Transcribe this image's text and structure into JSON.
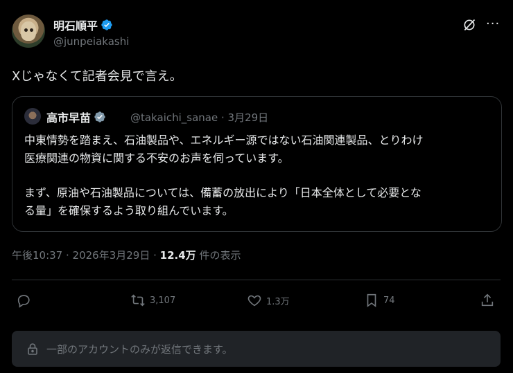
{
  "author": {
    "name": "明石順平",
    "handle": "@junpeiakashi",
    "verified": true
  },
  "post": {
    "text": "Xじゃなくて記者会見で言え。"
  },
  "quoted": {
    "name": "高市早苗",
    "handle": "@takaichi_sanae",
    "date": "· 3月29日",
    "paragraph1_line1": "中東情勢を踏まえ、石油製品や、エネルギー源ではない石油関連製品、とりわけ",
    "paragraph1_line2": "医療関連の物資に関する不安のお声を伺っています。",
    "paragraph2_line1": "まず、原油や石油製品については、備蓄の放出により「日本全体として必要とな",
    "paragraph2_line2": "る量」を確保するよう取り組んでいます。"
  },
  "meta": {
    "timestamp": "午後10:37 · 2026年3月29日 · ",
    "views": "12.4万",
    "views_label": " 件の表示"
  },
  "actions": {
    "retweets": "3,107",
    "likes": "1.3万",
    "bookmarks": "74"
  },
  "reply_restriction": "一部のアカウントのみが返信できます。",
  "colors": {
    "background": "#000000",
    "text": "#e7e9ea",
    "secondary": "#71767b",
    "verified_badge": "#1d9bf0",
    "border": "#2f3336"
  },
  "icons": [
    "verified-badge-icon",
    "grok-icon",
    "more-icon",
    "reply-icon",
    "retweet-icon",
    "like-icon",
    "bookmark-icon",
    "share-icon",
    "lock-icon"
  ]
}
